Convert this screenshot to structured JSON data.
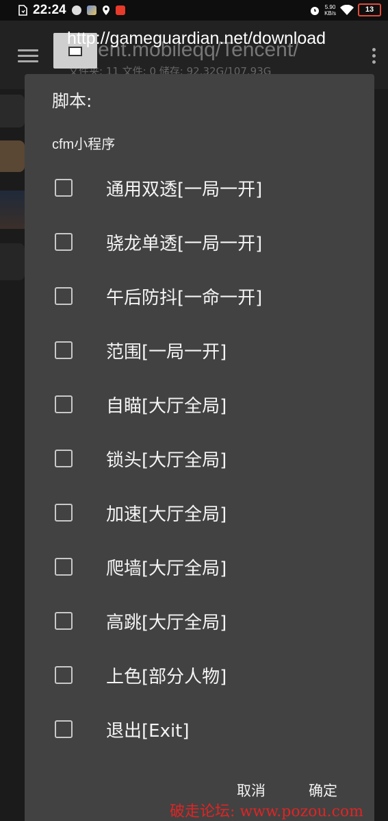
{
  "status_bar": {
    "time": "22:24",
    "net_speed_value": "5.90",
    "net_speed_unit": "KB/s",
    "battery": "13",
    "icons": [
      "file-icon",
      "app-icon",
      "game-icon",
      "location-icon",
      "notification-icon",
      "alarm-icon",
      "wifi-icon"
    ]
  },
  "background": {
    "url": "http://gameguardian.net/download",
    "path": "cent.mobileqq/Tencent/",
    "stats": "文件夹: 11  文件: 0  储存: 92.32G/107.93G"
  },
  "dialog": {
    "title": "脚本:",
    "subtitle": "cfm小程序",
    "options": [
      "通用双透[一局一开]",
      "骁龙单透[一局一开]",
      "午后防抖[一命一开]",
      "范围[一局一开]",
      "自瞄[大厅全局]",
      "锁头[大厅全局]",
      "加速[大厅全局]",
      "爬墙[大厅全局]",
      "高跳[大厅全局]",
      "上色[部分人物]",
      "退出[Exit]"
    ],
    "cancel_label": "取消",
    "ok_label": "确定"
  },
  "watermark": "破走论坛: www.pozou.com",
  "colors": {
    "dialog_bg": "#424242",
    "screen_bg": "#1b1b1b",
    "watermark": "#e02424",
    "battery_outline": "#e04a3a"
  }
}
